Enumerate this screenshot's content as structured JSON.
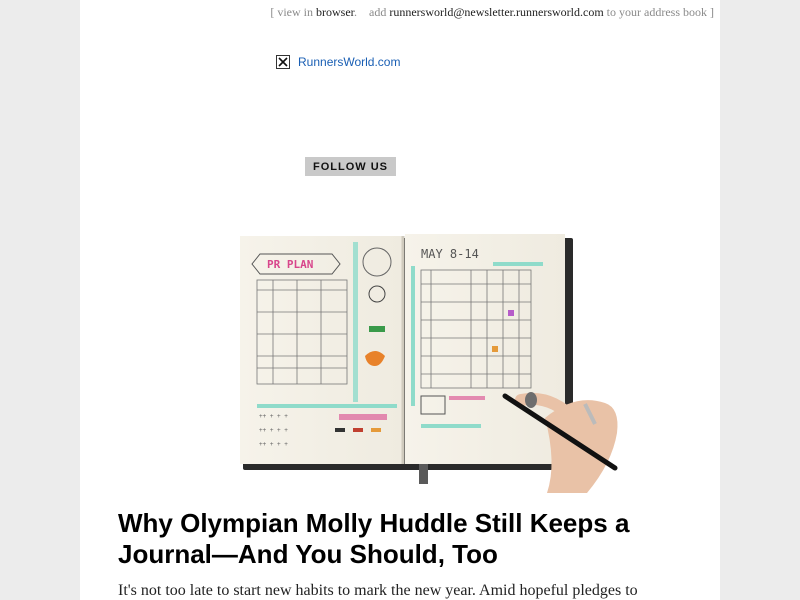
{
  "preheader": {
    "open_bracket": "[",
    "view_in": "view in",
    "browser_link": "browser",
    "period": ".",
    "add": "add",
    "email": "runnersworld@newsletter.runnersworld.com",
    "to_address_book": "to your address book",
    "close_bracket": "]"
  },
  "logo": {
    "alt_text": "RunnersWorld.com",
    "icon": "broken-image-icon"
  },
  "follow": {
    "label": "FOLLOW US"
  },
  "hero": {
    "subject": "bullet journal with hand holding pen",
    "heading_text": "MAY 8-14",
    "plan_text": "PR PLAN"
  },
  "article": {
    "headline": "Why Olympian Molly Huddle Still Keeps a Journal—And You Should, Too",
    "body": "It's not too late to start new habits to mark the new year. Amid hopeful pledges to"
  },
  "colors": {
    "link": "#1a5fb4",
    "accent_pink": "#d8468c",
    "accent_teal": "#7fd3c3",
    "follow_bg": "#c9c9c9"
  }
}
